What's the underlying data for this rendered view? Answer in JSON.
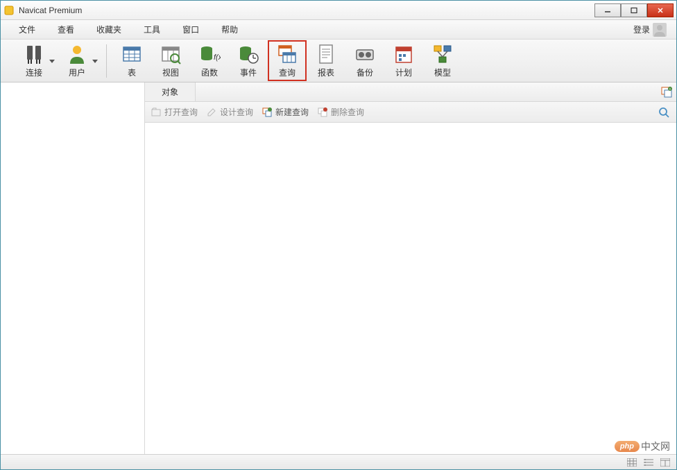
{
  "window": {
    "title": "Navicat Premium"
  },
  "menu": {
    "items": [
      "文件",
      "查看",
      "收藏夹",
      "工具",
      "窗口",
      "帮助"
    ],
    "login": "登录"
  },
  "toolbar": {
    "items": [
      {
        "label": "连接",
        "icon": "plug"
      },
      {
        "label": "用户",
        "icon": "user"
      },
      {
        "label": "表",
        "icon": "table"
      },
      {
        "label": "视图",
        "icon": "view"
      },
      {
        "label": "函数",
        "icon": "function"
      },
      {
        "label": "事件",
        "icon": "event"
      },
      {
        "label": "查询",
        "icon": "query",
        "highlighted": true
      },
      {
        "label": "报表",
        "icon": "report"
      },
      {
        "label": "备份",
        "icon": "backup"
      },
      {
        "label": "计划",
        "icon": "schedule"
      },
      {
        "label": "模型",
        "icon": "model"
      }
    ]
  },
  "object_tab": {
    "label": "对象"
  },
  "actions": {
    "open": "打开查询",
    "design": "设计查询",
    "new": "新建查询",
    "delete": "删除查询"
  },
  "watermark": {
    "badge": "php",
    "text": "中文网"
  }
}
